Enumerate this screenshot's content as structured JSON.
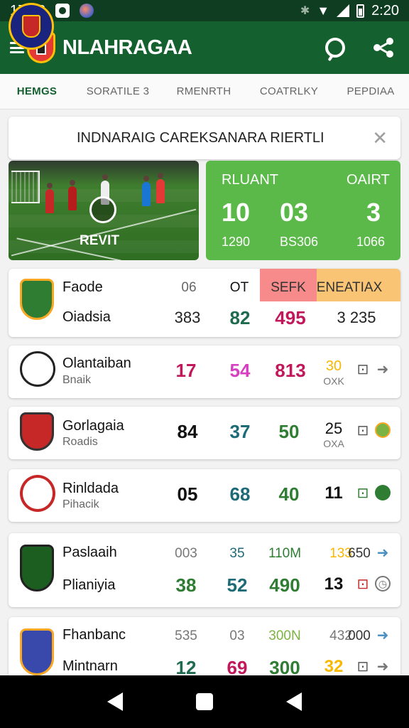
{
  "status_bar": {
    "time": "17:43",
    "clock_right": "2:20"
  },
  "app_bar": {
    "title": "NLAHRAGAA"
  },
  "tabs": [
    "HEMGS",
    "SORATILE 3",
    "RMENRTH",
    "COATRLKY",
    "PEPDIAA"
  ],
  "banner": {
    "text": "INDNARAIG CAREKSANARA RIERTLI"
  },
  "hero": {
    "video_label": "REVIT",
    "score_card": {
      "left_title": "RLUANT",
      "right_title": "OAIRT",
      "values": [
        "10",
        "03",
        "3"
      ],
      "subvalues": [
        "1290",
        "BS306",
        "1066"
      ]
    }
  },
  "table_header": {
    "c1": "06",
    "c2": "OT",
    "c3": "SEFK",
    "c4": "ENEATIAX"
  },
  "rows": [
    {
      "name": "Faode",
      "sub": "Oiadsia",
      "v1": "383",
      "v2": "82",
      "v3": "495",
      "v4": "3 235"
    },
    {
      "name": "Olantaiban",
      "sub": "Bnaik",
      "v1": "17",
      "v2": "54",
      "v3": "813",
      "v4": "30",
      "v4b": "OXK"
    },
    {
      "name": "Gorlagaia",
      "sub": "Roadis",
      "v1": "84",
      "v2": "37",
      "v3": "50",
      "v4": "25",
      "v4b": "OXA"
    },
    {
      "name": "Rinldada",
      "sub": "Pihacik",
      "v1": "05",
      "v2": "68",
      "v3": "40",
      "v4": "11"
    },
    {
      "name": "Paslaaih",
      "sub": "Plianiyia",
      "h1": "003",
      "h2": "35",
      "h3": "110M",
      "h4": "133",
      "h5": "650",
      "v1": "38",
      "v2": "52",
      "v3": "490",
      "v4": "13"
    },
    {
      "name": "Fhanbanc",
      "sub": "Mintnarn",
      "h1": "535",
      "h2": "03",
      "h3": "300N",
      "h4": "432",
      "h5": "000",
      "v1": "12",
      "v2": "69",
      "v3": "300",
      "v4": "32"
    }
  ]
}
